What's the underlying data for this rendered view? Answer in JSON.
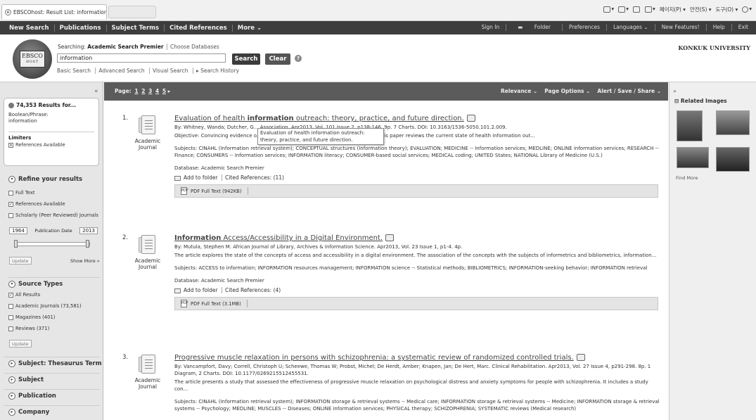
{
  "browser": {
    "tab_title": "EBSCOhost: Result List: information",
    "tools": [
      "페이지(P) ▾",
      "안전(S) ▾",
      "도구(O) ▾"
    ]
  },
  "nav": {
    "left": [
      "New Search",
      "Publications",
      "Subject Terms",
      "Cited References",
      "More ⌄"
    ],
    "right": [
      "Sign In",
      "Folder",
      "Preferences",
      "Languages ⌄",
      "New Features!",
      "Help",
      "Exit"
    ]
  },
  "search": {
    "logo_top": "EBSCO",
    "logo_bottom": "HOST",
    "searching_label": "Searching:",
    "database": "Academic Search Premier",
    "choose_databases": "Choose Databases",
    "query": "information",
    "search_label": "Search",
    "clear_label": "Clear",
    "help_icon": "?",
    "links": [
      "Basic Search",
      "Advanced Search",
      "Visual Search",
      "▸ Search History"
    ],
    "institution": "KONKUK UNIVERSITY"
  },
  "sidebar": {
    "collapse": "«",
    "results_for": "74,353 Results for...",
    "boolean_label": "Boolean/Phrase:",
    "boolean_value": "information",
    "limiters_label": "Limiters",
    "limiter_item": "References Available",
    "refine_label": "Refine your results",
    "refine_items": [
      {
        "label": "Full Text",
        "checked": false
      },
      {
        "label": "References Available",
        "checked": true
      },
      {
        "label": "Scholarly (Peer Reviewed) Journals",
        "checked": false
      }
    ],
    "date_from": "1964",
    "date_label": "Publication Date",
    "date_to": "2013",
    "update_label": "Update",
    "show_more": "Show More »",
    "source_types_label": "Source Types",
    "source_items": [
      {
        "label": "All Results",
        "checked": true
      },
      {
        "label": "Academic Journals (73,581)",
        "checked": false
      },
      {
        "label": "Magazines (401)",
        "checked": false
      },
      {
        "label": "Reviews (371)",
        "checked": false
      }
    ],
    "update2_label": "Update",
    "facets": [
      "Subject: Thesaurus Term",
      "Subject",
      "Publication",
      "Company"
    ]
  },
  "toolbar": {
    "page_label": "Page:",
    "pages": [
      "1",
      "2",
      "3",
      "4",
      "5",
      "▸"
    ],
    "relevance": "Relevance ⌄",
    "page_options": "Page Options ⌄",
    "alert": "Alert / Save / Share ⌄"
  },
  "results": [
    {
      "num": "1.",
      "type": "Academic Journal",
      "title_pre": "Evaluation of health ",
      "title_hl": "information",
      "title_post": " outreach: theory, practice, and future direction.",
      "byline": "By: Whitney, Wanda; Dutcher, G... Association. Apr2013, Vol. 101 Issue 2, p138-146. 9p. 7 Charts. DOI: 10.3163/1536-5050.101.2.009.",
      "abstract": "Objective: Convincing evidence o... projects is essential to ensure their continuity. This paper reviews the current state of health information out...",
      "subjects": "Subjects: CINAHL (Information retrieval system); CONCEPTUAL structures (Information theory); EVALUATION; MEDICINE -- Information services; MEDLINE; ONLINE information services; RESEARCH -- Finance; CONSUMERS -- Information services; INFORMATION literacy; CONSUMER-based social services; MEDICAL coding; UNITED States; NATIONAL Library of Medicine (U.S.)",
      "database": "Database: Academic Search Premier",
      "add_folder": "Add to folder",
      "cited": "Cited References: (11)",
      "pdf": "PDF Full Text (942KB)"
    },
    {
      "num": "2.",
      "type": "Academic Journal",
      "title_pre": "",
      "title_hl": "Information",
      "title_post": " Access/Accessibility in a Digital Environment.",
      "byline": "By: Mutula, Stephen M. African Journal of Library, Archives & Information Science. Apr2013, Vol. 23 Issue 1, p1-4. 4p.",
      "abstract": "The article explores the state of the concepts of access and accessibility in a digital environment. The association of the concepts with the subjects of informetrics and bibliometrics, information...",
      "subjects": "Subjects: ACCESS to information; INFORMATION resources management; INFORMATION science -- Statistical methods; BIBLIOMETRICS; INFORMATION-seeking behavior; INFORMATION retrieval",
      "database": "Database: Academic Search Premier",
      "add_folder": "Add to folder",
      "cited": "Cited References: (4)",
      "pdf": "PDF Full Text (3.1MB)"
    },
    {
      "num": "3.",
      "type": "Academic Journal",
      "title_pre": "Progressive muscle relaxation in persons with schizophrenia: a systematic review of randomized controlled trials.",
      "title_hl": "",
      "title_post": "",
      "byline": "By: Vancampfort, Davy; Correll, Christoph U; Scheewe, Thomas W; Probst, Michel; De Herdt, Amber; Knapen, Jan; De Hert, Marc. Clinical Rehabilitation. Apr2013, Vol. 27 Issue 4, p291-298. 8p. 1 Diagram, 2 Charts. DOI: 10.1177/0269215512455531.",
      "abstract": "The article presents a study that assessed the effectiveness of progressive muscle relaxation on psychological distress and anxiety symptoms for people with schizophrenia. It includes a study con...",
      "subjects": "Subjects: CINAHL (Information retrieval system); INFORMATION storage & retrieval systems -- Medical care; INFORMATION storage & retrieval systems -- Medicine; INFORMATION storage & retrieval systems -- Psychology; MEDLINE; MUSCLES -- Diseases; ONLINE information services; PHYSICAL therapy; SCHIZOPHRENIA; SYSTEMATIC reviews (Medical research)"
    }
  ],
  "tooltip": "Evaluation of health information outreach: theory, practice, and future direction.",
  "right": {
    "collapse": "»",
    "related_images": "Related Images",
    "find_more": "Find More"
  }
}
